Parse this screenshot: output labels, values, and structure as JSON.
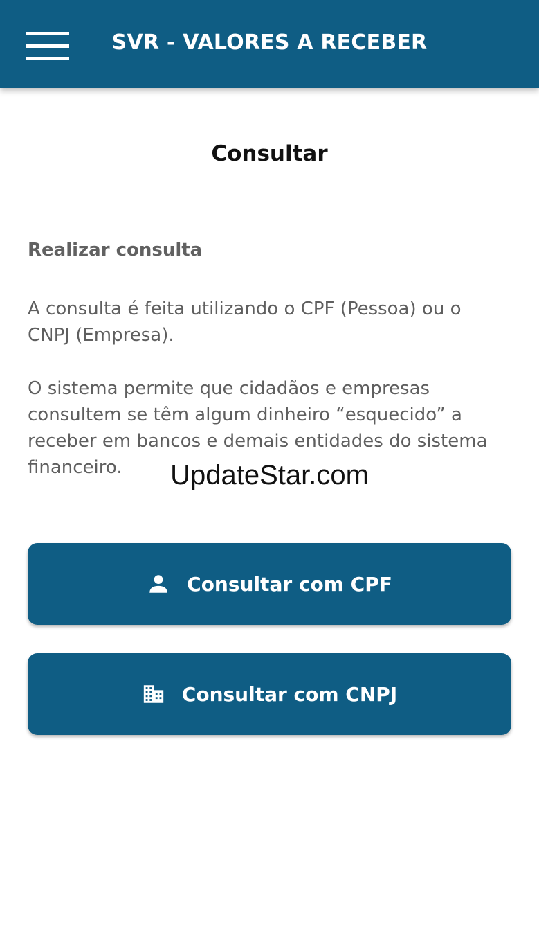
{
  "header": {
    "title": "SVR - VALORES A RECEBER",
    "menu_icon": "hamburger-menu-icon",
    "background": "#0f5d84"
  },
  "main": {
    "page_title": "Consultar",
    "section_heading": "Realizar consulta",
    "paragraph_1": "A consulta é feita utilizando o CPF (Pessoa) ou o CNPJ (Empresa).",
    "paragraph_2": "O sistema permite que cidadãos e empresas consultem se têm algum dinheiro “esquecido” a receber em bancos e demais entidades do sistema financeiro."
  },
  "watermark": "UpdateStar.com",
  "buttons": [
    {
      "label": "Consultar com CPF",
      "icon": "person-icon"
    },
    {
      "label": "Consultar com CNPJ",
      "icon": "building-icon"
    }
  ],
  "colors": {
    "accent": "#0f5d84",
    "text_muted": "#5f5f5f"
  }
}
